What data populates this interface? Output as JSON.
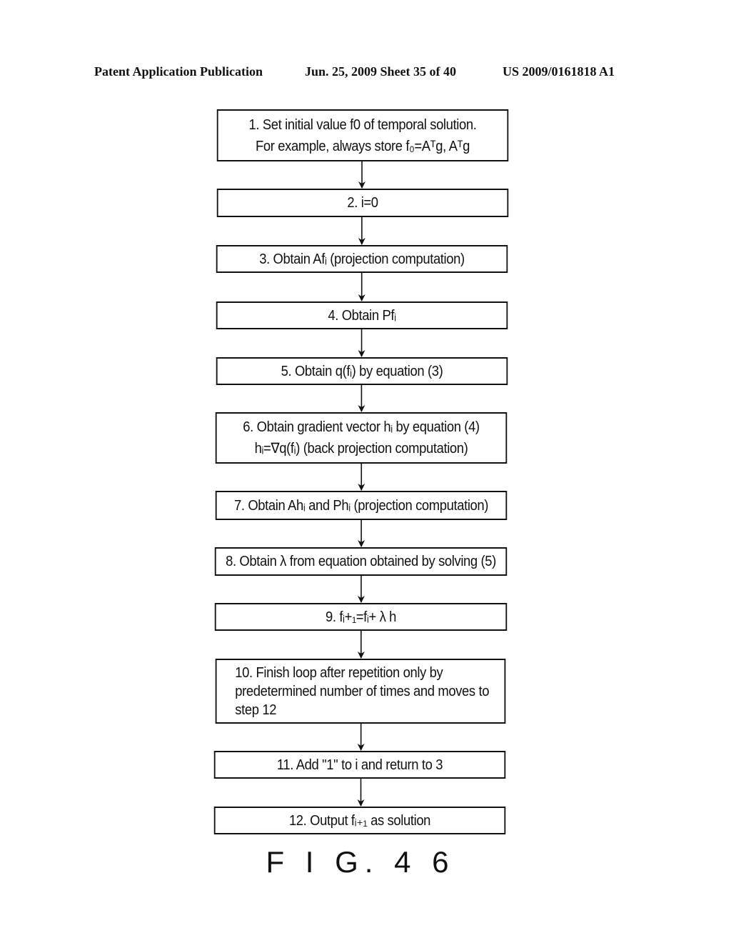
{
  "header": {
    "publication": "Patent Application Publication",
    "date_sheet": "Jun. 25, 2009  Sheet 35 of 40",
    "patent_number": "US 2009/0161818 A1"
  },
  "figure_label": "F I G. 4 6",
  "steps": [
    {
      "id": 1,
      "lines": [
        "1. Set initial value f0 of temporal solution.",
        "For example, always store f₀=Aᵀg, Aᵀg"
      ]
    },
    {
      "id": 2,
      "lines": [
        "2. i=0"
      ]
    },
    {
      "id": 3,
      "lines": [
        "3. Obtain Afᵢ (projection computation)"
      ]
    },
    {
      "id": 4,
      "lines": [
        "4. Obtain Pfᵢ"
      ]
    },
    {
      "id": 5,
      "lines": [
        "5. Obtain q(fᵢ) by equation (3)"
      ]
    },
    {
      "id": 6,
      "lines": [
        "6. Obtain gradient vector hᵢ by equation (4)",
        "hᵢ=∇q(fᵢ) (back projection computation)"
      ]
    },
    {
      "id": 7,
      "lines": [
        "7. Obtain Ahᵢ and Phᵢ (projection computation)"
      ]
    },
    {
      "id": 8,
      "lines": [
        "8. Obtain  λ  from equation obtained by solving (5)"
      ]
    },
    {
      "id": 9,
      "lines": [
        "9. fᵢ+₁=fᵢ+ λ h"
      ]
    },
    {
      "id": 10,
      "lines": [
        "10. Finish loop after repetition only by",
        "predetermined number of times and moves to",
        "step 12"
      ]
    },
    {
      "id": 11,
      "lines": [
        "11. Add \"1\" to i and return to 3"
      ]
    },
    {
      "id": 12,
      "lines": [
        "12. Output fᵢ₊₁ as solution"
      ]
    }
  ]
}
